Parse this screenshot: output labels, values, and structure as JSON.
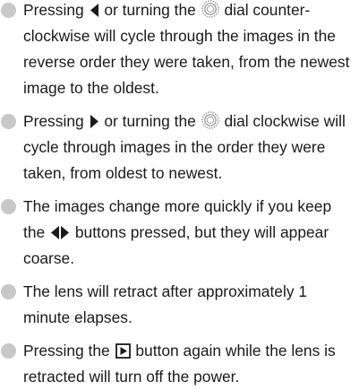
{
  "items": [
    {
      "a": "Pressing",
      "b": "or turning the",
      "c": "dial counter-clockwise will cycle through the images in the reverse order they were taken, from the newest image to the oldest."
    },
    {
      "a": "Pressing",
      "b": "or turning the",
      "c": "dial clockwise will cycle through images in the order they were taken, from oldest to newest."
    },
    {
      "a": "The images change more quickly if you keep the",
      "b": "buttons pressed, but they will appear coarse."
    },
    {
      "a": "The lens will retract after approximately 1 minute elapses."
    },
    {
      "a": "Pressing the",
      "b": "button again while the lens is retracted will turn off the power."
    }
  ],
  "icons": {
    "left_arrow": "left-arrow-icon",
    "right_arrow": "right-arrow-icon",
    "dial": "control-dial-icon",
    "left_right_arrows": "left-right-arrows-icon",
    "playback": "playback-button-icon"
  },
  "colors": {
    "bullet": "#c8c8c8",
    "text": "#1a1a1a",
    "icon": "#1a1a1a"
  }
}
